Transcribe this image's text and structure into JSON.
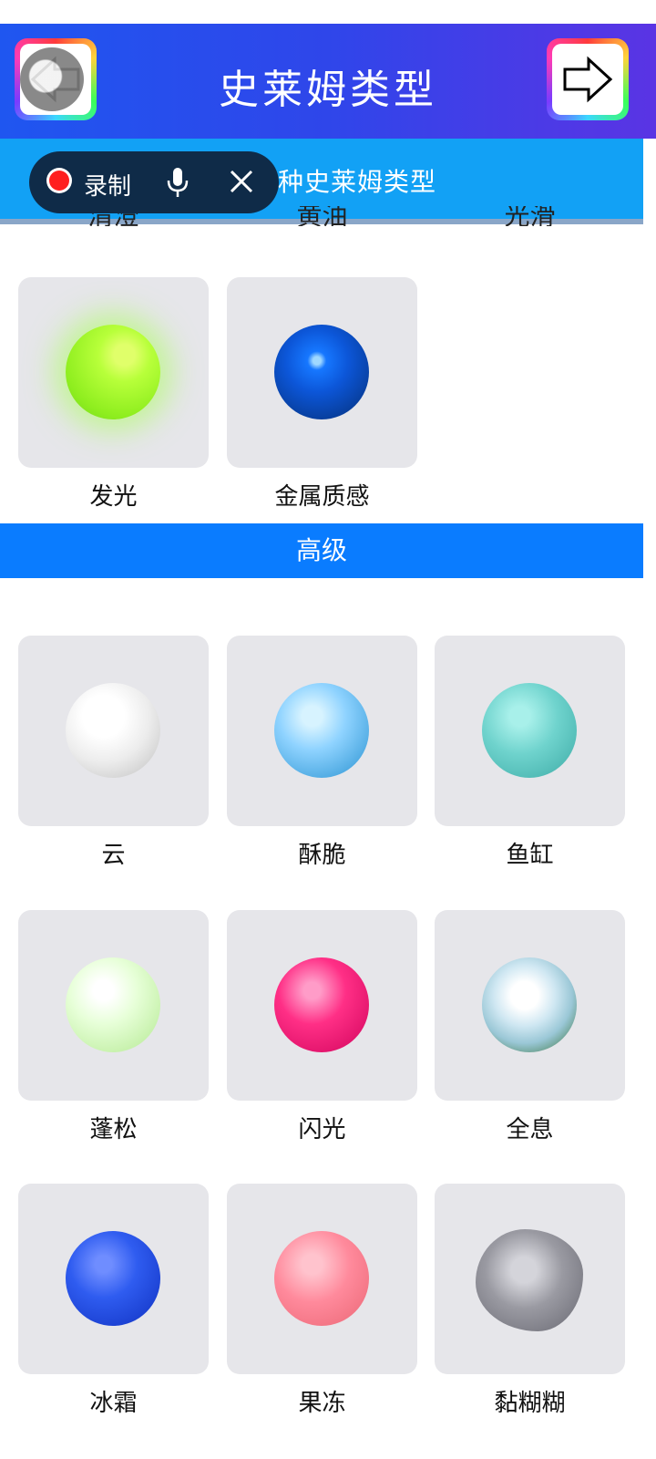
{
  "header": {
    "title": "史莱姆类型"
  },
  "subheader": {
    "text": "选择一种史莱姆类型"
  },
  "recorder": {
    "record_label": "录制"
  },
  "top_items": [
    {
      "label": "发光"
    },
    {
      "label": "金属质感"
    }
  ],
  "partial_row": [
    {
      "label": "清澄"
    },
    {
      "label": "黄油"
    },
    {
      "label": "光滑"
    }
  ],
  "advanced_section": {
    "title": "高级"
  },
  "advanced_items": [
    {
      "label": "云"
    },
    {
      "label": "酥脆"
    },
    {
      "label": "鱼缸"
    },
    {
      "label": "蓬松"
    },
    {
      "label": "闪光"
    },
    {
      "label": "全息"
    },
    {
      "label": "冰霜"
    },
    {
      "label": "果冻"
    },
    {
      "label": "黏糊糊"
    }
  ],
  "colors": {
    "header_gradient_start": "#1f56f0",
    "header_gradient_end": "#5a34e4",
    "subheader_bg": "#12a1f5",
    "section_bar_bg": "#0a7cff",
    "tile_bg": "#e6e6ea"
  }
}
